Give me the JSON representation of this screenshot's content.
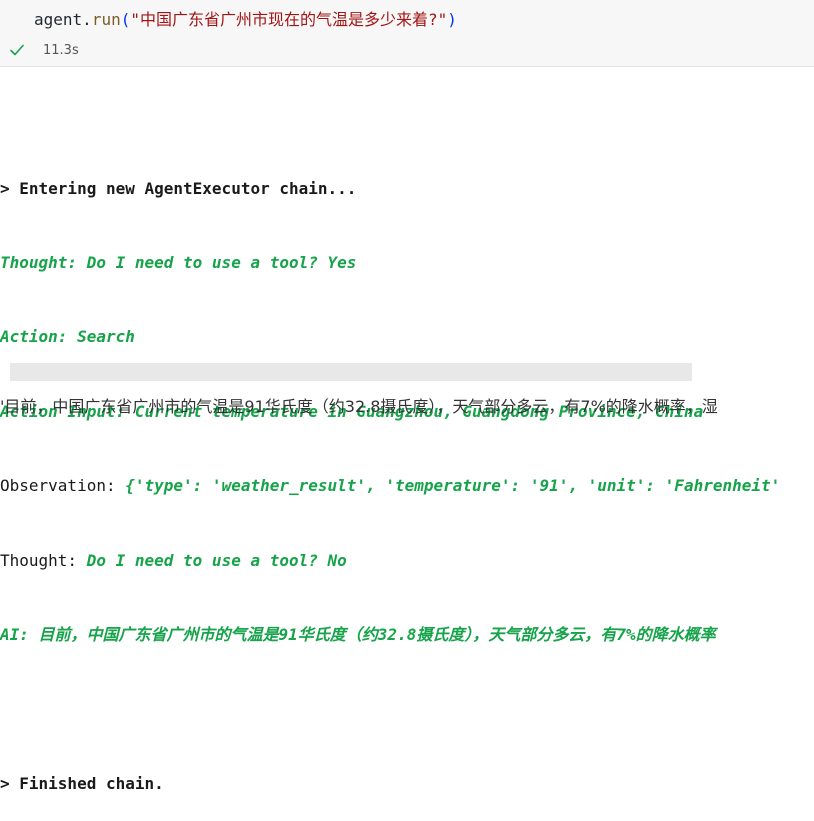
{
  "input_cell": {
    "code": {
      "obj": "agent",
      "dot": ".",
      "fn": "run",
      "open": "(",
      "arg": "\"中国广东省广州市现在的气温是多少来着?\"",
      "close": ")"
    },
    "status_icon": "check-icon",
    "exec_time": "11.3s",
    "status_color": "#16a34a"
  },
  "output": {
    "entering": "> Entering new AgentExecutor chain...",
    "thought1": "Thought: Do I need to use a tool? Yes",
    "action": "Action: Search",
    "action_input": "Action Input: Current temperature in Guangzhou, Guangdong Province, China",
    "observation_label": "Observation: ",
    "observation_value": "{'type': 'weather_result', 'temperature': '91', 'unit': 'Fahrenheit'",
    "thought2_label": "Thought: ",
    "thought2_value": "Do I need to use a tool? No",
    "ai_line": "AI: 目前，中国广东省广州市的气温是91华氏度（约32.8摄氏度），天气部分多云，有7%的降水概率",
    "finished": "> Finished chain."
  },
  "result_text": "'目前，中国广东省广州市的气温是91华氏度（约32.8摄氏度），天气部分多云，有7%的降水概率，湿",
  "colors": {
    "green_text": "#16a34a",
    "input_bg": "#f7f7f7"
  }
}
